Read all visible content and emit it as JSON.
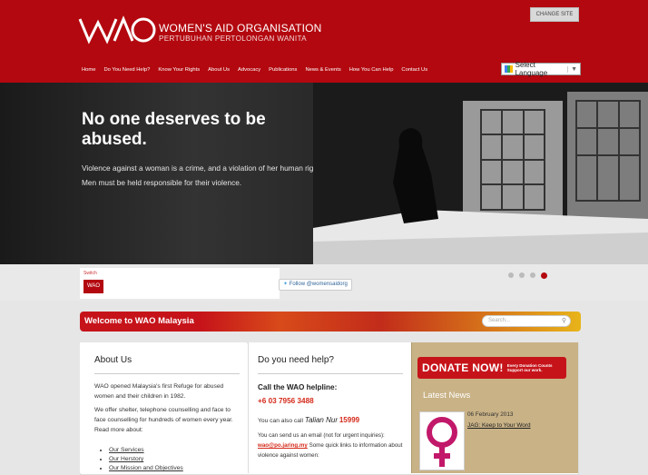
{
  "header": {
    "change_site": "CHANGE SITE",
    "logo_name": "WOMEN'S AID ORGANISATION",
    "logo_sub": "PERTUBUHAN PERTOLONGAN WANITA",
    "nav": [
      "Home",
      "Do You Need Help?",
      "Know Your Rights",
      "About Us",
      "Advocacy",
      "Publications",
      "News & Events",
      "How You Can Help",
      "Contact Us"
    ],
    "language": "Select Language",
    "brand_color": "#b3080f"
  },
  "hero": {
    "title": "No one deserves to be abused.",
    "body": "Violence against a woman is a crime, and a violation of her human rights. Men must be held responsible for their violence."
  },
  "strip": {
    "switch_label": "Switch",
    "switch_logo": "WAO",
    "follow": "Follow @womensaidorg",
    "slide_count": 4,
    "active_slide": 4
  },
  "welcome": {
    "title": "Welcome to WAO Malaysia",
    "search_placeholder": "Search..."
  },
  "about": {
    "title": "About Us",
    "text1": "WAO opened Malaysia's first Refuge for abused women and their children in 1982.",
    "text2": "We offer shelter, telephone counselling and face to face counselling for hundreds of women every year. Read more about:",
    "links": [
      "Our Services",
      "Our Herstory",
      "Our Mission and Objectives"
    ]
  },
  "help": {
    "title": "Do you need help?",
    "helpline_label": "Call the WAO helpline:",
    "phone": "+6 03 7956 3488",
    "also_call": "You can also call",
    "talian": "Talian Nur",
    "talian_num": "15999",
    "email_pre": "You can send us an email (not for urgent inquiries):",
    "email": "wao@po.jaring.my",
    "email_post": "Some quick links to information about violence against women:"
  },
  "sidebar": {
    "donate": "DONATE NOW!",
    "donate_tag1": "Every Donation Counts",
    "donate_tag2": "Support our work.",
    "latest_news": "Latest News",
    "news_date": "06 February 2013",
    "news_title": "JAG: Keep to Your Word"
  }
}
